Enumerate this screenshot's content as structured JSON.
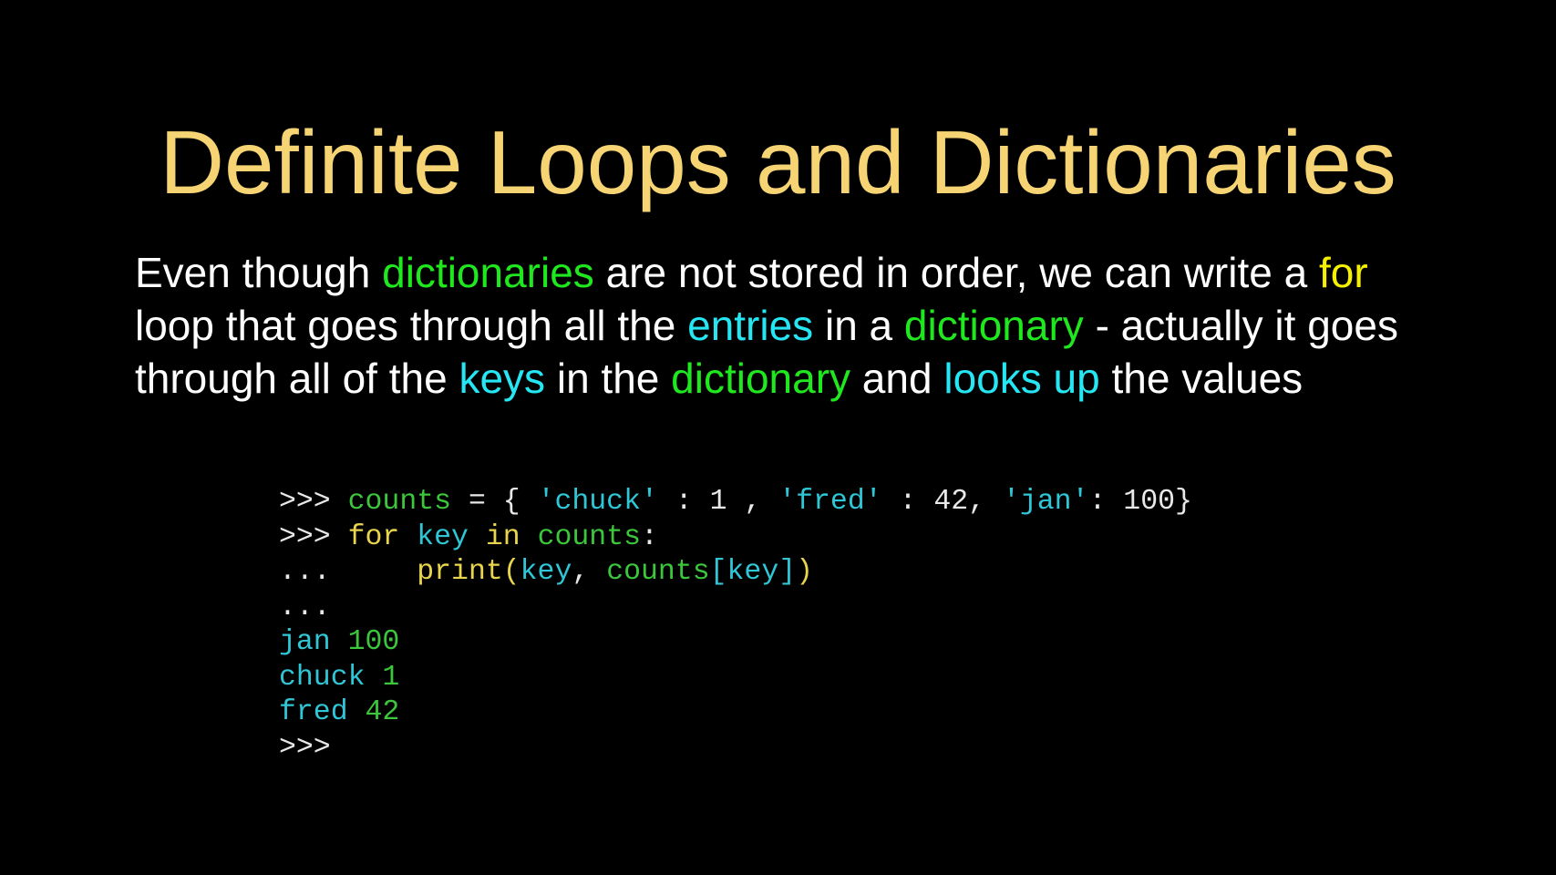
{
  "colors": {
    "background": "#000000",
    "title": "#f6d474",
    "text": "#ffffff",
    "green": "#1fe81f",
    "cyan": "#25e6f2",
    "yellow": "#f4f000",
    "code_default": "#e8e8e8",
    "code_green": "#3cc63c",
    "code_cyan": "#2fc6d6",
    "code_yellow": "#e8d44d"
  },
  "title": "Definite Loops and Dictionaries",
  "paragraph": [
    {
      "text": "Even though ",
      "color": "text"
    },
    {
      "text": "dictionaries",
      "color": "green"
    },
    {
      "text": " are not stored in order, we can write a ",
      "color": "text"
    },
    {
      "text": "for",
      "color": "yellow"
    },
    {
      "text": " loop that goes through all the ",
      "color": "text"
    },
    {
      "text": "entries",
      "color": "cyan"
    },
    {
      "text": " in a ",
      "color": "text"
    },
    {
      "text": "dictionary",
      "color": "green"
    },
    {
      "text": " - actually it goes through all of the ",
      "color": "text"
    },
    {
      "text": "keys",
      "color": "cyan"
    },
    {
      "text": " in the ",
      "color": "text"
    },
    {
      "text": "dictionary",
      "color": "green"
    },
    {
      "text": " and ",
      "color": "text"
    },
    {
      "text": "looks up",
      "color": "cyan"
    },
    {
      "text": " the values",
      "color": "text"
    }
  ],
  "code_lines": [
    [
      {
        "text": ">>> ",
        "color": "code_default"
      },
      {
        "text": "counts",
        "color": "code_green"
      },
      {
        "text": " = { ",
        "color": "code_default"
      },
      {
        "text": "'chuck'",
        "color": "code_cyan"
      },
      {
        "text": " : 1 , ",
        "color": "code_default"
      },
      {
        "text": "'fred'",
        "color": "code_cyan"
      },
      {
        "text": " : 42, ",
        "color": "code_default"
      },
      {
        "text": "'jan'",
        "color": "code_cyan"
      },
      {
        "text": ": 100}",
        "color": "code_default"
      }
    ],
    [
      {
        "text": ">>> ",
        "color": "code_default"
      },
      {
        "text": "for",
        "color": "code_yellow"
      },
      {
        "text": " ",
        "color": "code_default"
      },
      {
        "text": "key",
        "color": "code_cyan"
      },
      {
        "text": " ",
        "color": "code_default"
      },
      {
        "text": "in",
        "color": "code_yellow"
      },
      {
        "text": " ",
        "color": "code_default"
      },
      {
        "text": "counts",
        "color": "code_green"
      },
      {
        "text": ":",
        "color": "code_default"
      }
    ],
    [
      {
        "text": "...     ",
        "color": "code_default"
      },
      {
        "text": "print(",
        "color": "code_yellow"
      },
      {
        "text": "key",
        "color": "code_cyan"
      },
      {
        "text": ", ",
        "color": "code_default"
      },
      {
        "text": "counts",
        "color": "code_green"
      },
      {
        "text": "[key]",
        "color": "code_cyan"
      },
      {
        "text": ")",
        "color": "code_yellow"
      }
    ],
    [
      {
        "text": "...",
        "color": "code_default"
      }
    ],
    [
      {
        "text": "jan",
        "color": "code_cyan"
      },
      {
        "text": " 100",
        "color": "code_green"
      }
    ],
    [
      {
        "text": "chuck",
        "color": "code_cyan"
      },
      {
        "text": " 1",
        "color": "code_green"
      }
    ],
    [
      {
        "text": "fred",
        "color": "code_cyan"
      },
      {
        "text": " 42",
        "color": "code_green"
      }
    ],
    [
      {
        "text": ">>>",
        "color": "code_default"
      }
    ]
  ]
}
